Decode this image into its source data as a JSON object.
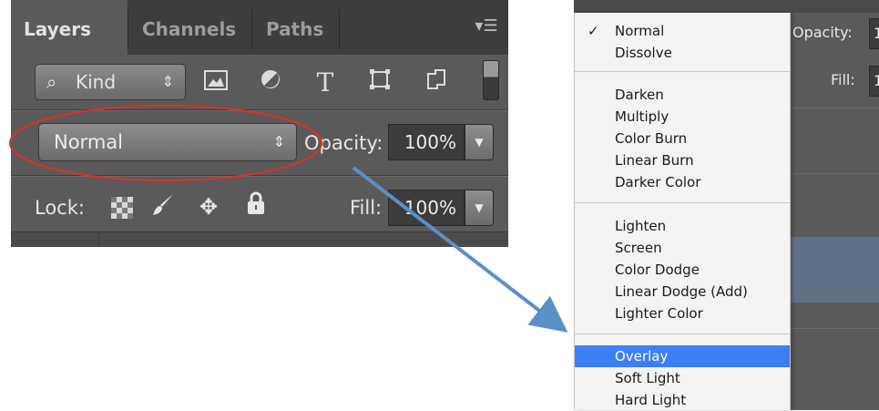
{
  "layers_panel": {
    "tabs": [
      "Layers",
      "Channels",
      "Paths"
    ],
    "filter": {
      "kind_label": "Kind",
      "icons": [
        "search-icon",
        "updown-arrows-icon",
        "image-icon",
        "adjustment-circle-icon",
        "type-T-icon",
        "shape-icon",
        "smart-object-icon"
      ]
    },
    "blend_mode_value": "Normal",
    "opacity_label": "Opacity:",
    "opacity_value": "100%",
    "lock_label": "Lock:",
    "fill_label": "Fill:",
    "fill_value": "100%"
  },
  "right_panel": {
    "opacity_label": "Opacity:",
    "opacity_value": "1",
    "fill_label": "Fill:",
    "fill_value": "1"
  },
  "blend_menu": {
    "checked_item": "Normal",
    "highlighted_item": "Overlay",
    "groups": [
      [
        "Normal",
        "Dissolve"
      ],
      [
        "Darken",
        "Multiply",
        "Color Burn",
        "Linear Burn",
        "Darker Color"
      ],
      [
        "Lighten",
        "Screen",
        "Color Dodge",
        "Linear Dodge (Add)",
        "Lighter Color"
      ],
      [
        "Overlay",
        "Soft Light",
        "Hard Light"
      ]
    ]
  },
  "colors": {
    "panel_bg": "#5a5a5a",
    "tabbar_bg": "#3d3d3d",
    "menu_bg": "#f3f3f3",
    "menu_highlight": "#3d7ef4",
    "annotation_ellipse": "#d8322a",
    "annotation_arrow": "#5b8fc8"
  }
}
